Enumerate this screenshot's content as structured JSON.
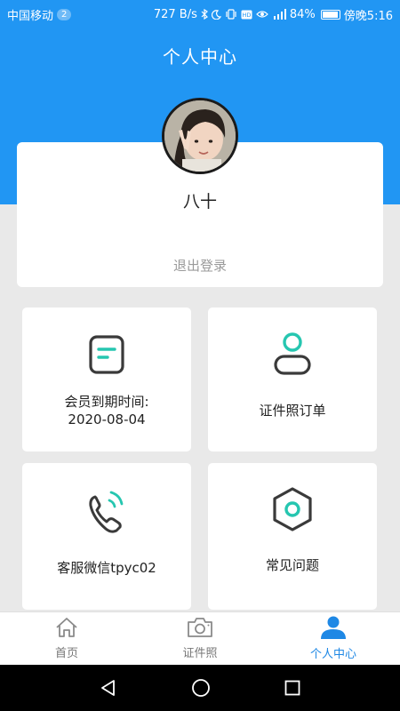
{
  "status_bar": {
    "carrier": "中国移动",
    "notification_count": "2",
    "speed": "727 B/s",
    "battery": "84%",
    "time": "傍晚5:16"
  },
  "header": {
    "title": "个人中心"
  },
  "profile": {
    "nickname": "八十",
    "logout_label": "退出登录"
  },
  "grid": [
    {
      "icon": "membership-card-icon",
      "label_line1": "会员到期时间:",
      "label_line2": "2020-08-04"
    },
    {
      "icon": "person-icon",
      "label": "证件照订单"
    },
    {
      "icon": "phone-icon",
      "label": "客服微信tpyc02"
    },
    {
      "icon": "hexagon-settings-icon",
      "label": "常见问题"
    }
  ],
  "tabs": [
    {
      "icon": "home-icon",
      "label": "首页",
      "active": false
    },
    {
      "icon": "camera-icon",
      "label": "证件照",
      "active": false
    },
    {
      "icon": "user-icon",
      "label": "个人中心",
      "active": true
    }
  ],
  "colors": {
    "primary": "#2196f3",
    "accent_teal": "#26c6b0",
    "tab_active": "#1e88e5",
    "icon_dark": "#3a3a3a"
  }
}
